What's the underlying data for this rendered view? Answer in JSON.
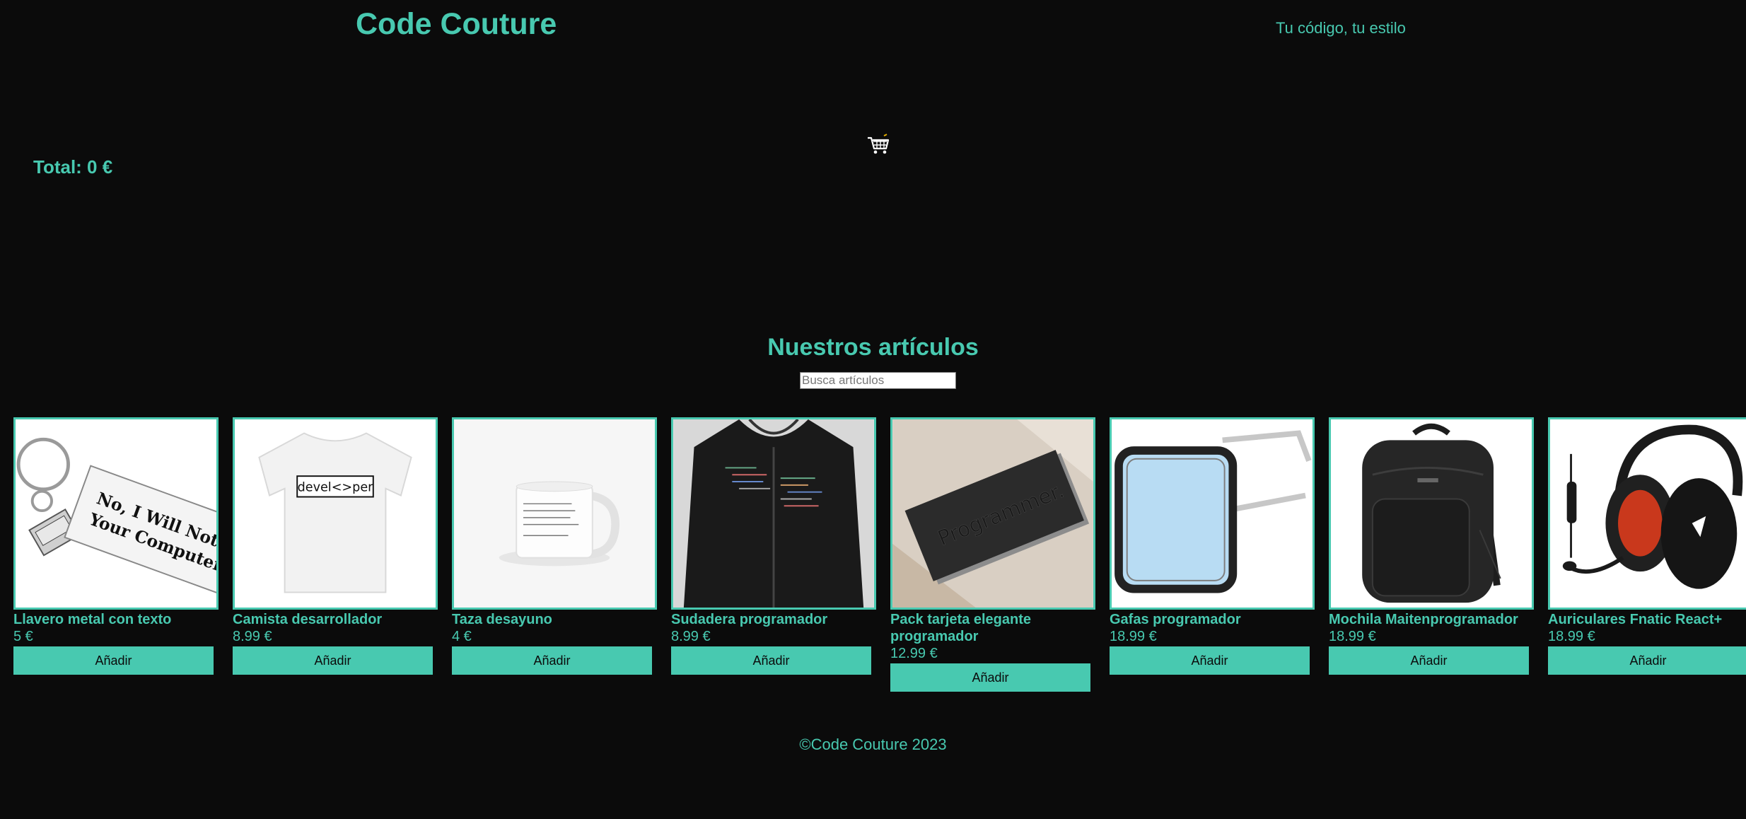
{
  "header": {
    "brand": "Code Couture",
    "tagline": "Tu código, tu estilo"
  },
  "cart": {
    "icon": "shopping-cart-icon",
    "total": "Total: 0 €"
  },
  "catalog": {
    "title": "Nuestros artículos",
    "search_placeholder": "Busca artículos",
    "add_label": "Añadir",
    "products": [
      {
        "name": "Llavero metal con texto",
        "price": "5 €",
        "image_text": "No, I Will Not Fix Your Computer"
      },
      {
        "name": "Camista desarrollador",
        "price": "8.99 €",
        "image_text": "devel<>per"
      },
      {
        "name": "Taza desayuno",
        "price": "4 €"
      },
      {
        "name": "Sudadera programador",
        "price": "8.99 €"
      },
      {
        "name": "Pack tarjeta elegante programador",
        "price": "12.99 €",
        "image_text": "Programmer."
      },
      {
        "name": "Gafas programador",
        "price": "18.99 €"
      },
      {
        "name": "Mochila Maitenprogramador",
        "price": "18.99 €"
      },
      {
        "name": "Auriculares Fnatic React+",
        "price": "18.99 €"
      }
    ]
  },
  "footer": {
    "text": "©Code Couture 2023"
  },
  "colors": {
    "accent": "#48c9b0",
    "background": "#0b0b0b"
  }
}
